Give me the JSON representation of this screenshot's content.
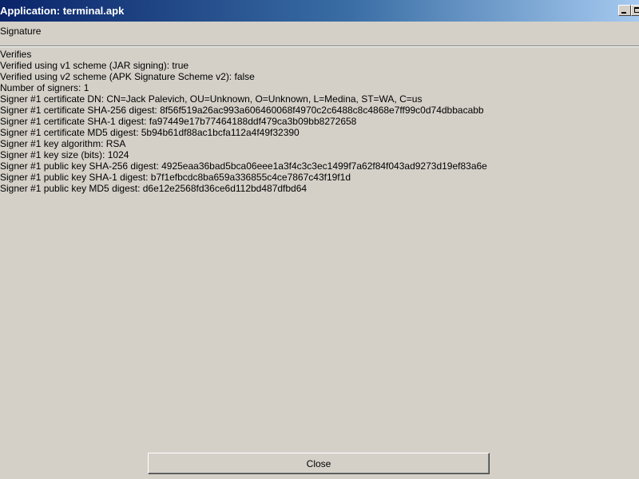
{
  "window": {
    "title": "Application: terminal.apk",
    "buttons": [
      "minimize",
      "maximize"
    ]
  },
  "tabs": [
    {
      "label": "Signature"
    }
  ],
  "section": {
    "header": "Verifies"
  },
  "lines": [
    "Verified using v1 scheme (JAR signing): true",
    "Verified using v2 scheme (APK Signature Scheme v2): false",
    "Number of signers: 1",
    "Signer #1 certificate DN: CN=Jack Palevich, OU=Unknown, O=Unknown, L=Medina, ST=WA, C=us",
    "Signer #1 certificate SHA-256 digest: 8f56f519a26ac993a606460068f4970c2c6488c8c4868e7ff99c0d74dbbacabb",
    "Signer #1 certificate SHA-1 digest: fa97449e17b77464188ddf479ca3b09bb8272658",
    "Signer #1 certificate MD5 digest: 5b94b61df88ac1bcfa112a4f49f32390",
    "Signer #1 key algorithm: RSA",
    "Signer #1 key size (bits): 1024",
    "Signer #1 public key SHA-256 digest: 4925eaa36bad5bca06eee1a3f4c3c3ec1499f7a62f84f043ad9273d19ef83a6e",
    "Signer #1 public key SHA-1 digest: b7f1efbcdc8ba659a336855c4ce7867c43f19f1d",
    "Signer #1 public key MD5 digest: d6e12e2568fd36ce6d112bd487dfbd64"
  ],
  "footer": {
    "close_label": "Close"
  },
  "colors": {
    "window_bg": "#d4d0c8",
    "titlebar_start": "#0a246a",
    "titlebar_end": "#a6caf0",
    "title_text": "#ffffff"
  }
}
